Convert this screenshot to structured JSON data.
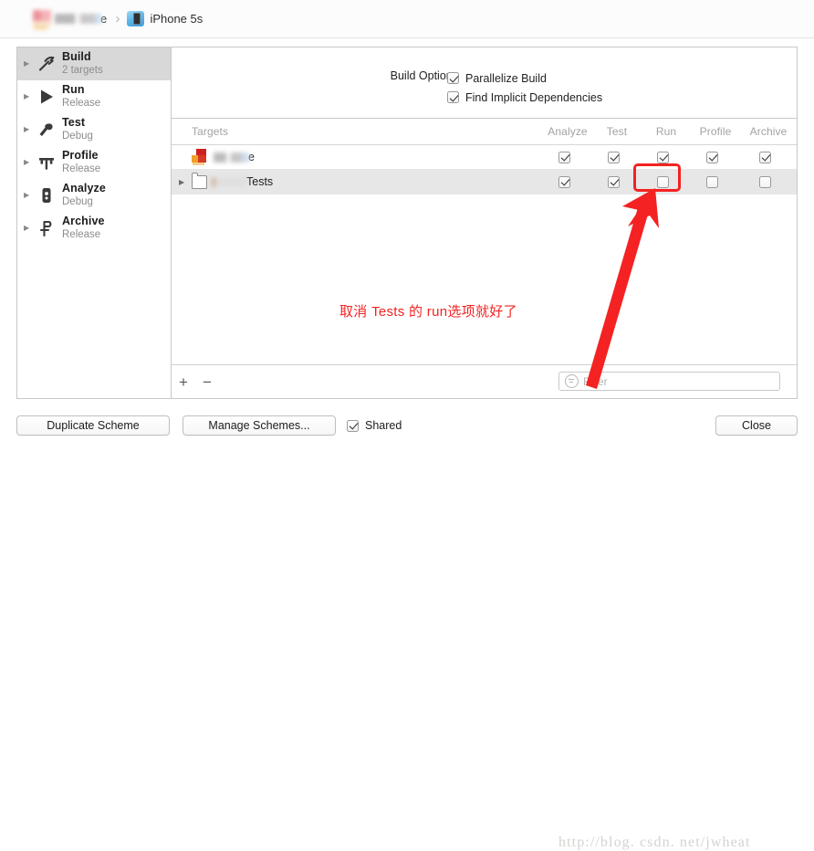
{
  "topbar": {
    "scheme_name_tail": "e",
    "separator": "›",
    "device_name": "iPhone 5s",
    "scheme_icon": "xcode-scheme-icon",
    "device_glyph": "iphone-simulator-icon"
  },
  "sidebar": {
    "items": [
      {
        "title": "Build",
        "subtitle": "2 targets",
        "glyph": "hammer-icon",
        "selected": true
      },
      {
        "title": "Run",
        "subtitle": "Release",
        "glyph": "play-icon",
        "selected": false
      },
      {
        "title": "Test",
        "subtitle": "Debug",
        "glyph": "wrench-icon",
        "selected": false
      },
      {
        "title": "Profile",
        "subtitle": "Release",
        "glyph": "gauge-icon",
        "selected": false
      },
      {
        "title": "Analyze",
        "subtitle": "Debug",
        "glyph": "microscope-icon",
        "selected": false
      },
      {
        "title": "Archive",
        "subtitle": "Release",
        "glyph": "archive-icon",
        "selected": false
      }
    ]
  },
  "build_options": {
    "label": "Build Options",
    "options": [
      {
        "label": "Parallelize Build",
        "checked": true
      },
      {
        "label": "Find Implicit Dependencies",
        "checked": true
      }
    ]
  },
  "targets_table": {
    "headers": [
      "Targets",
      "Analyze",
      "Test",
      "Run",
      "Profile",
      "Archive"
    ],
    "rows": [
      {
        "icon": "app-target-icon",
        "name_tail": "e",
        "name_redacted": true,
        "expandable": false,
        "analyze": true,
        "test": true,
        "run": true,
        "profile": true,
        "archive": true
      },
      {
        "icon": "test-bundle-icon",
        "name_tail": "Tests",
        "name_redacted": true,
        "expandable": true,
        "analyze": true,
        "test": true,
        "run": false,
        "profile": false,
        "archive": false
      }
    ]
  },
  "table_footer": {
    "add_label": "+",
    "remove_label": "−",
    "filter_placeholder": "Filter",
    "filter_value": "",
    "filter_icon": "filter-icon"
  },
  "bottom_bar": {
    "duplicate_scheme": "Duplicate Scheme",
    "manage_schemes": "Manage Schemes...",
    "shared_label": "Shared",
    "shared_checked": true,
    "close": "Close"
  },
  "annotations": {
    "note_text": "取消 Tests 的 run选项就好了",
    "highlight_color": "#f42222",
    "arrow": "red-arrow-pointing-to-run-checkbox",
    "watermark": "http://blog. csdn. net/jwheat"
  }
}
